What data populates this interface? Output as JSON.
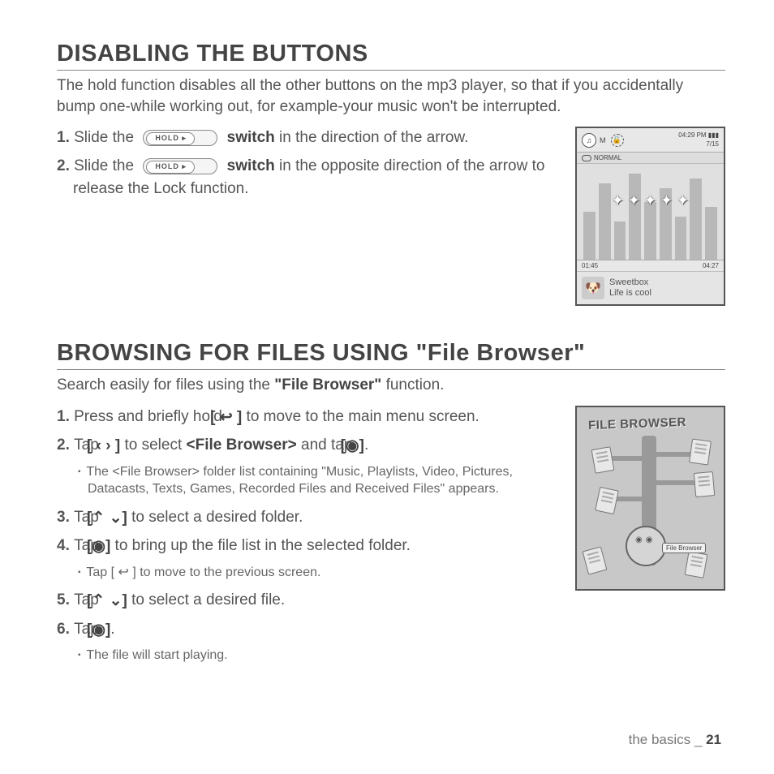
{
  "section1": {
    "heading": "DISABLING THE BUTTONS",
    "intro": "The hold function disables all the other buttons on the mp3 player, so that if you accidentally bump one-while working out, for example-your music won't be interrupted.",
    "step1_a": "Slide the",
    "step1_b": "switch",
    "step1_c": " in the direction of the arrow.",
    "step2_a": "Slide the",
    "step2_b": "switch",
    "step2_c": " in the opposite direction of the arrow to release the Lock function.",
    "switch_label": "HOLD ▸"
  },
  "device1": {
    "mode_label": "M",
    "time": "04:29 PM",
    "battery": "▮▮▮",
    "count": "7/15",
    "eq": "NORMAL",
    "elapsed": "01:45",
    "total": "04:27",
    "artist": "Sweetbox",
    "song": "Life is cool"
  },
  "section2": {
    "heading": "BROWSING FOR FILES USING \"File Browser\"",
    "intro_a": "Search easily for files using the ",
    "intro_b": "\"File Browser\"",
    "intro_c": " function.",
    "step1_a": "Press and briefly hold ",
    "step1_icon": "[ ↩ ]",
    "step1_b": " to move to the main menu screen.",
    "step2_a": "Tap ",
    "step2_icon1": "[ ‹  › ]",
    "step2_b": " to select ",
    "step2_target": "<File Browser>",
    "step2_c": " and tap ",
    "step2_icon2": "[◉]",
    "step2_d": ".",
    "step2_sub": "The <File Browser> folder list containing \"Music, Playlists, Video, Pictures, Datacasts, Texts, Games, Recorded Files and Received Files\" appears.",
    "step3_a": "Tap ",
    "step3_icon": "[⌃ ⌄]",
    "step3_b": " to select a desired folder.",
    "step4_a": "Tap ",
    "step4_icon": "[◉]",
    "step4_b": " to bring up the file list in the selected folder.",
    "step4_sub_a": "Tap [",
    "step4_sub_icon": " ↩ ",
    "step4_sub_b": "] to move to the previous screen.",
    "step5_a": "Tap ",
    "step5_icon": "[⌃ ⌄]",
    "step5_b": " to select a desired file.",
    "step6_a": " Tap ",
    "step6_icon": "[◉]",
    "step6_b": ".",
    "step6_sub": "The file will start playing."
  },
  "device2": {
    "title": "FILE BROWSER",
    "tag": "File Browser"
  },
  "footer": {
    "section": "the basics _ ",
    "page": "21"
  }
}
